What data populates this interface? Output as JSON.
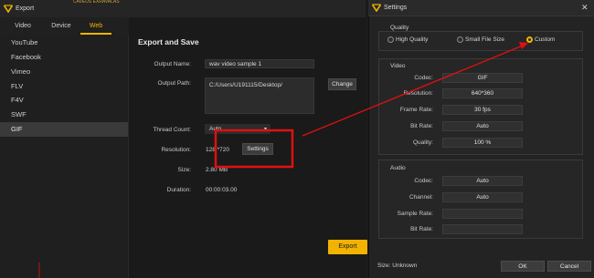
{
  "export": {
    "window_title": "Export",
    "bg_strip": "CAVEUS  EXRAVALAS",
    "tabs": [
      {
        "label": "Video",
        "active": false
      },
      {
        "label": "Device",
        "active": false
      },
      {
        "label": "Web",
        "active": true
      }
    ],
    "formats": [
      {
        "label": "YouTube",
        "active": false
      },
      {
        "label": "Facebook",
        "active": false
      },
      {
        "label": "Vimeo",
        "active": false
      },
      {
        "label": "FLV",
        "active": false
      },
      {
        "label": "F4V",
        "active": false
      },
      {
        "label": "SWF",
        "active": false
      },
      {
        "label": "GIF",
        "active": true
      }
    ],
    "section_title": "Export and Save",
    "output_name_label": "Output Name:",
    "output_name_value": "wav video sample 1",
    "output_path_label": "Output Path:",
    "output_path_value": "C:/Users/U191115/Desktop/",
    "change_label": "Change",
    "thread_count_label": "Thread Count:",
    "thread_count_value": "Auto",
    "resolution_label": "Resolution:",
    "resolution_value": "128 *720",
    "settings_button_label": "Settings",
    "size_label": "Size:",
    "size_value": "2.80 MB",
    "duration_label": "Duration:",
    "duration_value": "00:00:03.00",
    "export_button_label": "Export"
  },
  "settings": {
    "window_title": "Settings",
    "close_glyph": "✕",
    "quality_title": "Quality",
    "quality_options": [
      {
        "label": "High Quality",
        "selected": false
      },
      {
        "label": "Small File Size",
        "selected": false
      },
      {
        "label": "Custom",
        "selected": true
      }
    ],
    "video_title": "Video",
    "codec_label": "Codec:",
    "codec_value": "GIF",
    "resolution_label": "Resolution:",
    "resolution_value": "640*360",
    "frame_rate_label": "Frame Rate:",
    "frame_rate_value": "30 fps",
    "bit_rate_label": "Bit Rate:",
    "bit_rate_value": "Auto",
    "quality_label": "Quality:",
    "quality_value": "100 %",
    "audio_title": "Audio",
    "audio_codec_label": "Codec:",
    "audio_codec_value": "Auto",
    "channel_label": "Channel:",
    "channel_value": "Auto",
    "sample_rate_label": "Sample Rate:",
    "sample_rate_value": "",
    "audio_bit_rate_label": "Bit Rate:",
    "audio_bit_rate_value": "",
    "size_status": "Size: Unknown",
    "ok_label": "OK",
    "cancel_label": "Cancel"
  },
  "colors": {
    "accent": "#f0b400",
    "annotation_red": "#e01010"
  },
  "icons": {
    "app_logo": "app-logo-icon",
    "close": "close-icon",
    "dropdown": "chevron-down-icon"
  }
}
